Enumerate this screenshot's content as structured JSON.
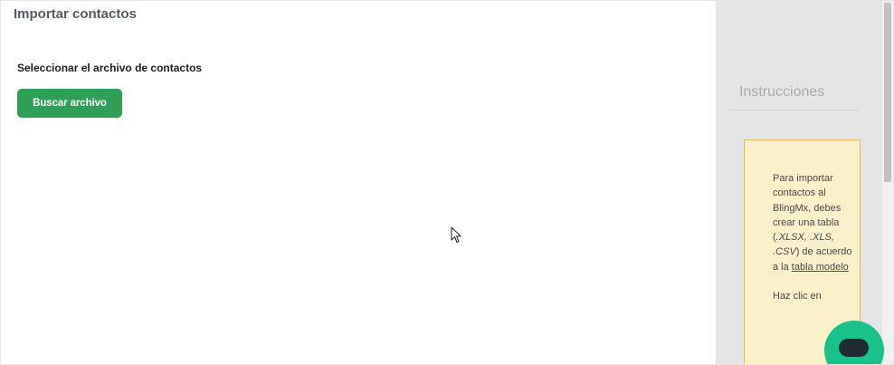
{
  "header": {
    "title": "Importar contactos"
  },
  "upload": {
    "label": "Seleccionar el archivo de contactos",
    "button_label": "Buscar archivo"
  },
  "sidebar": {
    "title": "Instrucciones",
    "note": {
      "text_before": "Para importar contactos al BlingMx, debes crear una tabla (",
      "formats": ".XLSX, .XLS, .CSV",
      "text_after": ") de acuerdo a la ",
      "link_label": "tabla modelo",
      "second_paragraph": "Haz clic en"
    }
  },
  "colors": {
    "primary_button": "#2f9f55",
    "chat_button": "#19c28a",
    "note_background": "#fcf0c8",
    "note_border": "#f3b84a"
  },
  "icons": [
    "mouse-pointer-icon",
    "chat-bubble-icon"
  ]
}
